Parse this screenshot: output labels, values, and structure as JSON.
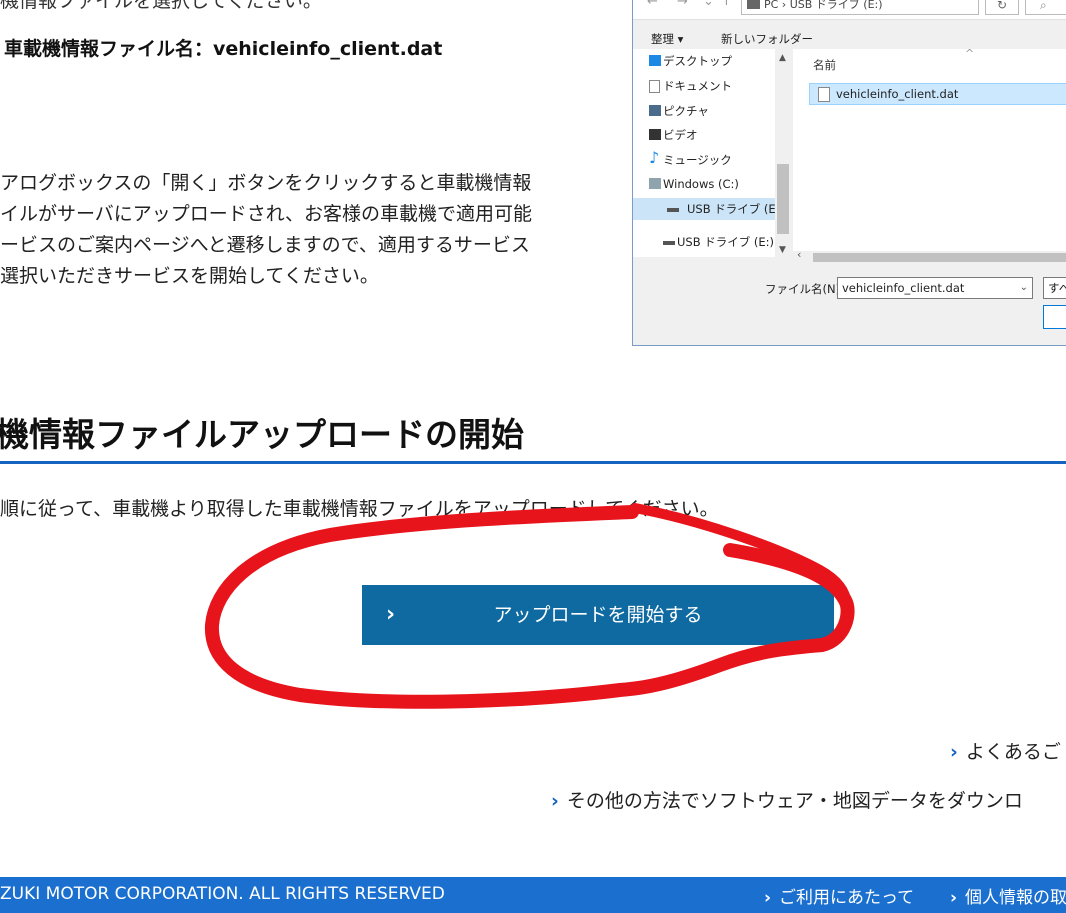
{
  "top": {
    "cut_text": "機情報ファイルを選択してください。",
    "filename_line": "車載機情報ファイル名：vehicleinfo_client.dat",
    "paragraph": [
      "アログボックスの「開く」ボタンをクリックすると車載機情報",
      "イルがサーバにアップロードされ、お客様の車載機で適用可能",
      "ービスのご案内ページへと遷移しますので、適用するサービス",
      "選択いただきサービスを開始してください。"
    ]
  },
  "dialog": {
    "path": "PC › USB ドライブ (E:)",
    "refresh": "↻",
    "search": "⌕",
    "toolbar": {
      "organize": "整理 ▾",
      "new_folder": "新しいフォルダー"
    },
    "nav_items": [
      {
        "label": "デスクトップ",
        "icon": "desktop-icon"
      },
      {
        "label": "ドキュメント",
        "icon": "documents-icon"
      },
      {
        "label": "ピクチャ",
        "icon": "pictures-icon"
      },
      {
        "label": "ビデオ",
        "icon": "videos-icon"
      },
      {
        "label": "ミュージック",
        "icon": "music-icon"
      },
      {
        "label": "Windows (C:)",
        "icon": "windows-drive-icon"
      },
      {
        "label": "USB ドライブ (E:)",
        "icon": "usb-drive-icon"
      },
      {
        "label": "USB ドライブ (E:)",
        "icon": "usb-drive-icon"
      }
    ],
    "column_name": "名前",
    "file": "vehicleinfo_client.dat",
    "filename_label": "ファイル名(N):",
    "filename_value": "vehicleinfo_client.dat",
    "type_label": "すべ"
  },
  "section": {
    "title": "機情報ファイルアップロードの開始",
    "intro": "順に従って、車載機より取得した車載機情報ファイルをアップロードしてください。",
    "upload_button": "アップロードを開始する"
  },
  "links": {
    "faq": "よくあるご",
    "other_method": "その他の方法でソフトウェア・地図データをダウンロ"
  },
  "footer": {
    "copyright": "ZUKI MOTOR CORPORATION. ALL RIGHTS RESERVED",
    "terms": "ご利用にあたって",
    "privacy": "個人情報の取"
  },
  "colors": {
    "accent": "#1565c0",
    "button": "#0e6aa0",
    "footer": "#1a6fcf",
    "annotation": "#e8141b"
  }
}
